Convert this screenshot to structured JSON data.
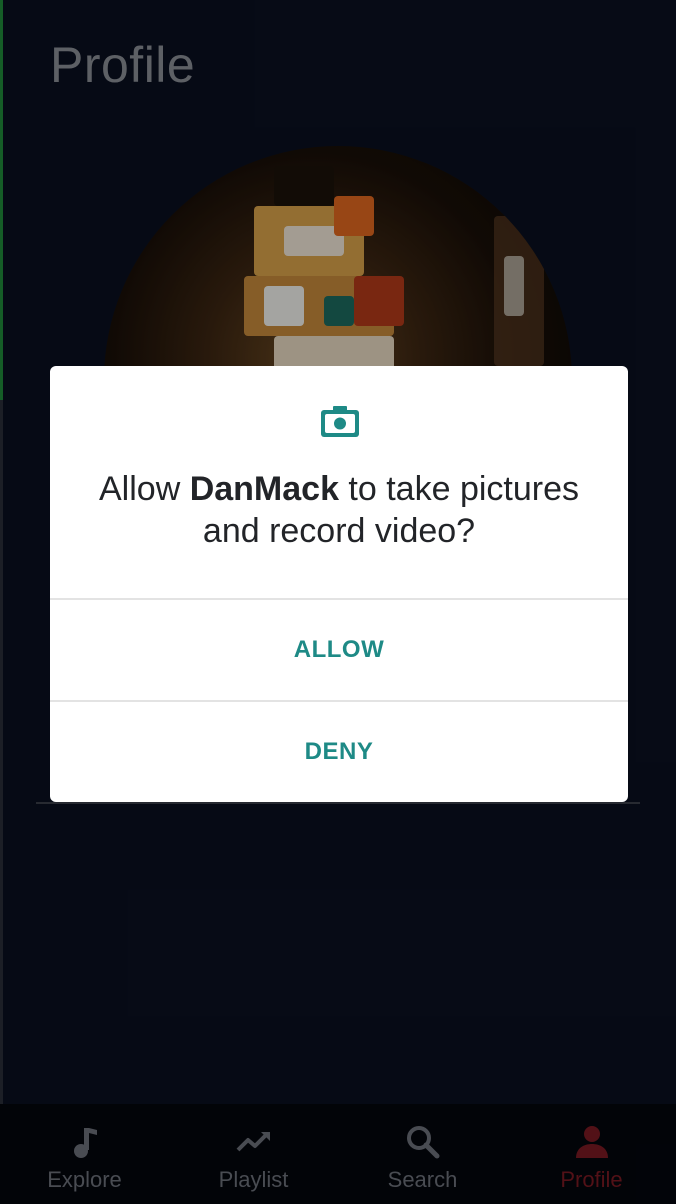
{
  "header": {
    "title": "Profile"
  },
  "dialog": {
    "message_prefix": "Allow ",
    "app_name": "DanMack",
    "message_suffix": " to take pictures and record video?",
    "allow_label": "ALLOW",
    "deny_label": "DENY",
    "icon": "camera-icon",
    "accent_color": "#1e8a86"
  },
  "bottom_nav": {
    "items": [
      {
        "label": "Explore",
        "icon": "music-note-icon",
        "active": false
      },
      {
        "label": "Playlist",
        "icon": "trending-up-icon",
        "active": false
      },
      {
        "label": "Search",
        "icon": "search-icon",
        "active": false
      },
      {
        "label": "Profile",
        "icon": "person-icon",
        "active": true
      }
    ],
    "active_color": "#7a1a22"
  }
}
